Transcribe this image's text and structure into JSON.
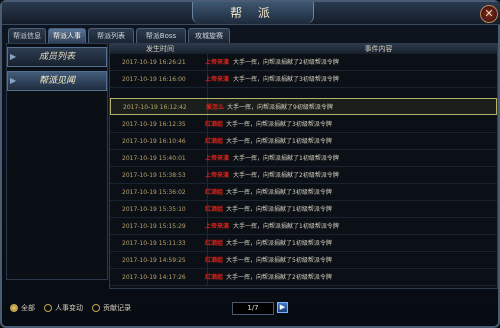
{
  "window": {
    "title": "帮 派",
    "close_label": "✕"
  },
  "tabs": [
    {
      "label": "帮派信息"
    },
    {
      "label": "帮派人事"
    },
    {
      "label": "帮派列表"
    },
    {
      "label": "帮派Boss"
    },
    {
      "label": "攻城旋赛"
    }
  ],
  "left_menu": [
    {
      "label": "成员列表"
    },
    {
      "label": "帮派见闻"
    }
  ],
  "grid": {
    "col_time": "发生时间",
    "col_content": "事件内容",
    "rows": [
      {
        "time": "2017-10-19 16:26:21",
        "actor": "上帝来演",
        "msg": "大手一挥，向帮派捐献了2初级帮派令牌"
      },
      {
        "time": "2017-10-19 16:16:00",
        "actor": "上帝来演",
        "msg": "大手一挥，向帮派捐献了3初级帮派令牌"
      },
      {
        "time": "2017-10-19 16:12:42",
        "actor": "爱怎么",
        "msg": "大手一挥，向帮派捐献了9初级帮派令牌"
      },
      {
        "time": "2017-10-19 16:12:35",
        "actor": "红酒姐",
        "msg": "大手一挥，向帮派捐献了3初级帮派令牌"
      },
      {
        "time": "2017-10-19 16:10:46",
        "actor": "红酒姐",
        "msg": "大手一挥，向帮派捐献了1初级帮派令牌"
      },
      {
        "time": "2017-10-19 15:40:01",
        "actor": "上帝来演",
        "msg": "大手一挥，向帮派捐献了1初级帮派令牌"
      },
      {
        "time": "2017-10-19 15:38:53",
        "actor": "上帝来演",
        "msg": "大手一挥，向帮派捐献了2初级帮派令牌"
      },
      {
        "time": "2017-10-19 15:36:02",
        "actor": "红酒姐",
        "msg": "大手一挥，向帮派捐献了3初级帮派令牌"
      },
      {
        "time": "2017-10-19 15:35:10",
        "actor": "红酒姐",
        "msg": "大手一挥，向帮派捐献了1初级帮派令牌"
      },
      {
        "time": "2017-10-19 15:15:29",
        "actor": "上帝来演",
        "msg": "大手一挥，向帮派捐献了1初级帮派令牌"
      },
      {
        "time": "2017-10-19 15:11:33",
        "actor": "红酒姐",
        "msg": "大手一挥，向帮派捐献了1初级帮派令牌"
      },
      {
        "time": "2017-10-19 14:59:25",
        "actor": "红酒姐",
        "msg": "大手一挥，向帮派捐献了5初级帮派令牌"
      },
      {
        "time": "2017-10-19 14:17:26",
        "actor": "红酒姐",
        "msg": "大手一挥，向帮派捐献了2初级帮派令牌"
      }
    ]
  },
  "filters": [
    {
      "label": "全部",
      "checked": true
    },
    {
      "label": "人事变动",
      "checked": false
    },
    {
      "label": "贡献记录",
      "checked": false
    }
  ],
  "pager": {
    "value": "1/7",
    "next": "▶"
  },
  "colors": {
    "accent": "#b7b06a",
    "actor": "#d6241b",
    "time": "#b9a46a"
  }
}
